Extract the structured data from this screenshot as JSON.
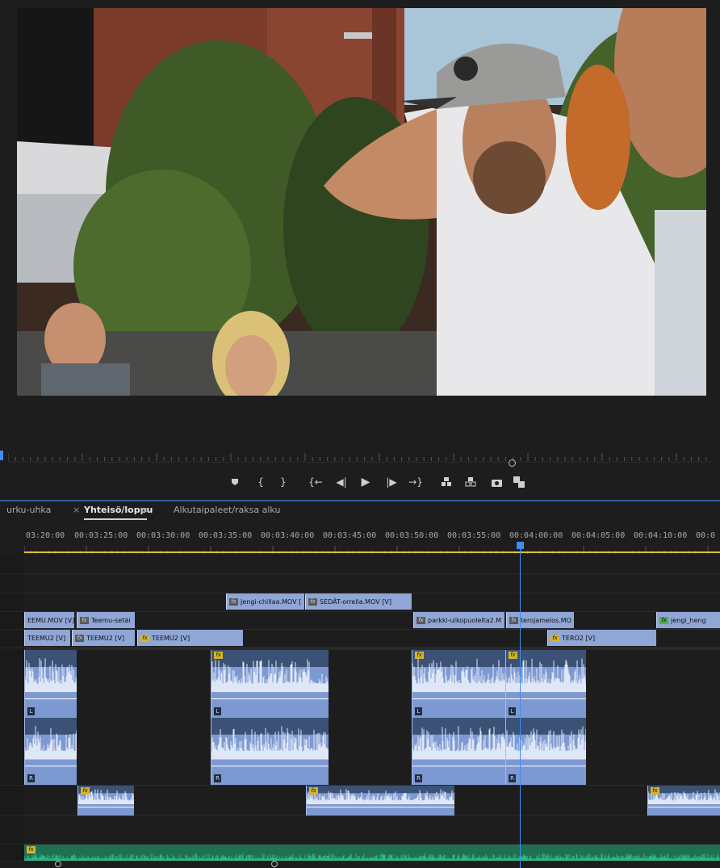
{
  "program_monitor": {
    "frame_description": "",
    "transport_icons": [
      "marker-icon",
      "mark-in-icon",
      "mark-out-icon",
      "go-to-in-icon",
      "step-back-icon",
      "play-icon",
      "step-forward-icon",
      "go-to-out-icon",
      "lift-icon",
      "extract-icon",
      "export-frame-icon",
      "button-editor-icon"
    ]
  },
  "tabs": {
    "items": [
      {
        "label": "urku-uhka"
      },
      {
        "label": "Yhteisö/loppu"
      },
      {
        "label": "Alkutaipaleet/raksa alku"
      }
    ],
    "close_glyph": "×",
    "menu_glyph": "≡"
  },
  "timecodes": [
    "03:20:00",
    "00:03:25:00",
    "00:03:30:00",
    "00:03:35:00",
    "00:03:40:00",
    "00:03:45:00",
    "00:03:50:00",
    "00:03:55:00",
    "00:04:00:00",
    "00:04:05:00",
    "00:04:10:00",
    "00:0"
  ],
  "clips": {
    "v3": [
      {
        "name": "Jengi-chillaa.MOV [",
        "fx": "fx"
      },
      {
        "name": "SEDÄT-orrella.MOV [V]",
        "fx": "fx"
      }
    ],
    "v2": [
      {
        "name": "EEMU.MOV [V]",
        "fx": ""
      },
      {
        "name": "Teemu-setäi",
        "fx": "fx"
      },
      {
        "name": "parkki-ulkopuolelta2.M",
        "fx": "fx"
      },
      {
        "name": "terojamelos.MO",
        "fx": "fx"
      },
      {
        "name": "jengi_heng",
        "fx": "fx"
      }
    ],
    "v1": [
      {
        "name": "TEEMU2 [V]",
        "fx": ""
      },
      {
        "name": "TEEMU2 [V]",
        "fx": "fx"
      },
      {
        "name": "TEEMU2 [V]",
        "fx": "fx"
      },
      {
        "name": "TERO2 [V]",
        "fx": "fx"
      }
    ],
    "audio_channel_left": "L",
    "audio_channel_right": "R",
    "fx_badge": "fx"
  },
  "colors": {
    "video_clip": "#8fa6d6",
    "audio_clip": "#7d99d1",
    "music_clip": "#2fb784",
    "playhead": "#3f8ef0",
    "work_area": "#d9c233",
    "fx_badge": "#d4b42a"
  }
}
